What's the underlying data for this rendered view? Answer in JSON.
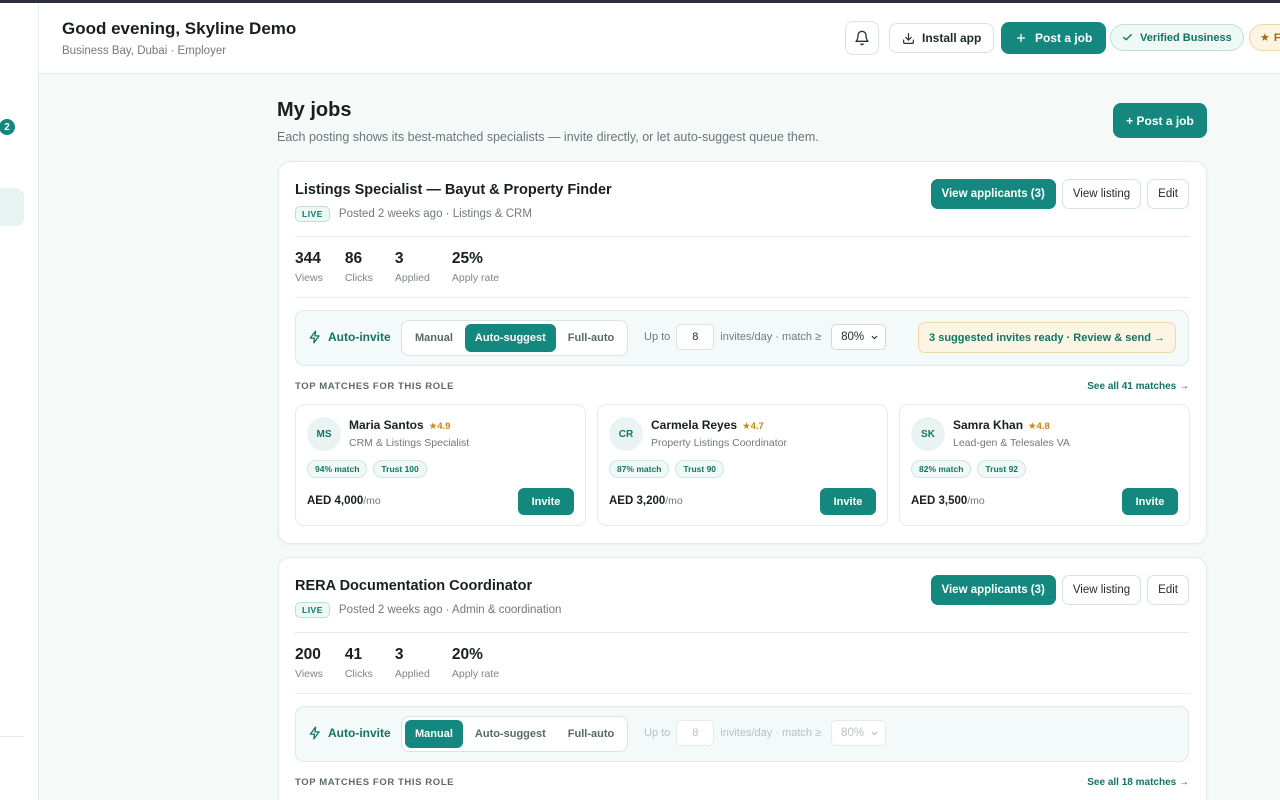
{
  "header": {
    "greeting": "Good evening, Skyline Demo",
    "location": "Business Bay, Dubai · Employer",
    "install_label": "Install app",
    "post_label": "Post a job",
    "verified_label": "Verified Business",
    "featured_label": "Fe"
  },
  "sidebar": {
    "badge": "2"
  },
  "main": {
    "title": "My jobs",
    "subtitle": "Each posting shows its best-matched specialists — invite directly, or let auto-suggest queue them.",
    "post_label": "+ Post a job"
  },
  "jobs": [
    {
      "title": "Listings Specialist — Bayut & Property Finder",
      "status": "LIVE",
      "meta": "Posted 2 weeks ago · Listings & CRM",
      "actions": {
        "applicants": "View applicants (3)",
        "view": "View listing",
        "edit": "Edit"
      },
      "stats": [
        {
          "value": "344",
          "label": "Views"
        },
        {
          "value": "86",
          "label": "Clicks"
        },
        {
          "value": "3",
          "label": "Applied"
        },
        {
          "value": "25%",
          "label": "Apply rate"
        }
      ],
      "auto_invite": {
        "label": "Auto-invite",
        "modes": [
          "Manual",
          "Auto-suggest",
          "Full-auto"
        ],
        "active_mode": "Auto-suggest",
        "up_to": "Up to",
        "limit": "8",
        "per_day": "invites/day · match ≥",
        "threshold": "80%",
        "ready": "3 suggested invites ready · Review & send →"
      },
      "top_matches_heading": "TOP MATCHES FOR THIS ROLE",
      "see_all": "See all 41 matches →",
      "matches": [
        {
          "initials": "MS",
          "name": "Maria Santos",
          "rating": "★4.9",
          "role": "CRM & Listings Specialist",
          "match": "94% match",
          "trust": "Trust 100",
          "price": "AED 4,000",
          "period": "/mo",
          "invite": "Invite"
        },
        {
          "initials": "CR",
          "name": "Carmela Reyes",
          "rating": "★4.7",
          "role": "Property Listings Coordinator",
          "match": "87% match",
          "trust": "Trust 90",
          "price": "AED 3,200",
          "period": "/mo",
          "invite": "Invite"
        },
        {
          "initials": "SK",
          "name": "Samra Khan",
          "rating": "★4.8",
          "role": "Lead-gen & Telesales VA",
          "match": "82% match",
          "trust": "Trust 92",
          "price": "AED 3,500",
          "period": "/mo",
          "invite": "Invite"
        }
      ]
    },
    {
      "title": "RERA Documentation Coordinator",
      "status": "LIVE",
      "meta": "Posted 2 weeks ago · Admin & coordination",
      "actions": {
        "applicants": "View applicants (3)",
        "view": "View listing",
        "edit": "Edit"
      },
      "stats": [
        {
          "value": "200",
          "label": "Views"
        },
        {
          "value": "41",
          "label": "Clicks"
        },
        {
          "value": "3",
          "label": "Applied"
        },
        {
          "value": "20%",
          "label": "Apply rate"
        }
      ],
      "auto_invite": {
        "label": "Auto-invite",
        "modes": [
          "Manual",
          "Auto-suggest",
          "Full-auto"
        ],
        "active_mode": "Manual",
        "up_to": "Up to",
        "limit": "8",
        "per_day": "invites/day · match ≥",
        "threshold": "80%"
      },
      "top_matches_heading": "TOP MATCHES FOR THIS ROLE",
      "see_all": "See all 18 matches →"
    }
  ],
  "colors": {
    "accent": "#14877e",
    "accent_text": "#137367",
    "warning_bg": "#fdf4e3"
  }
}
